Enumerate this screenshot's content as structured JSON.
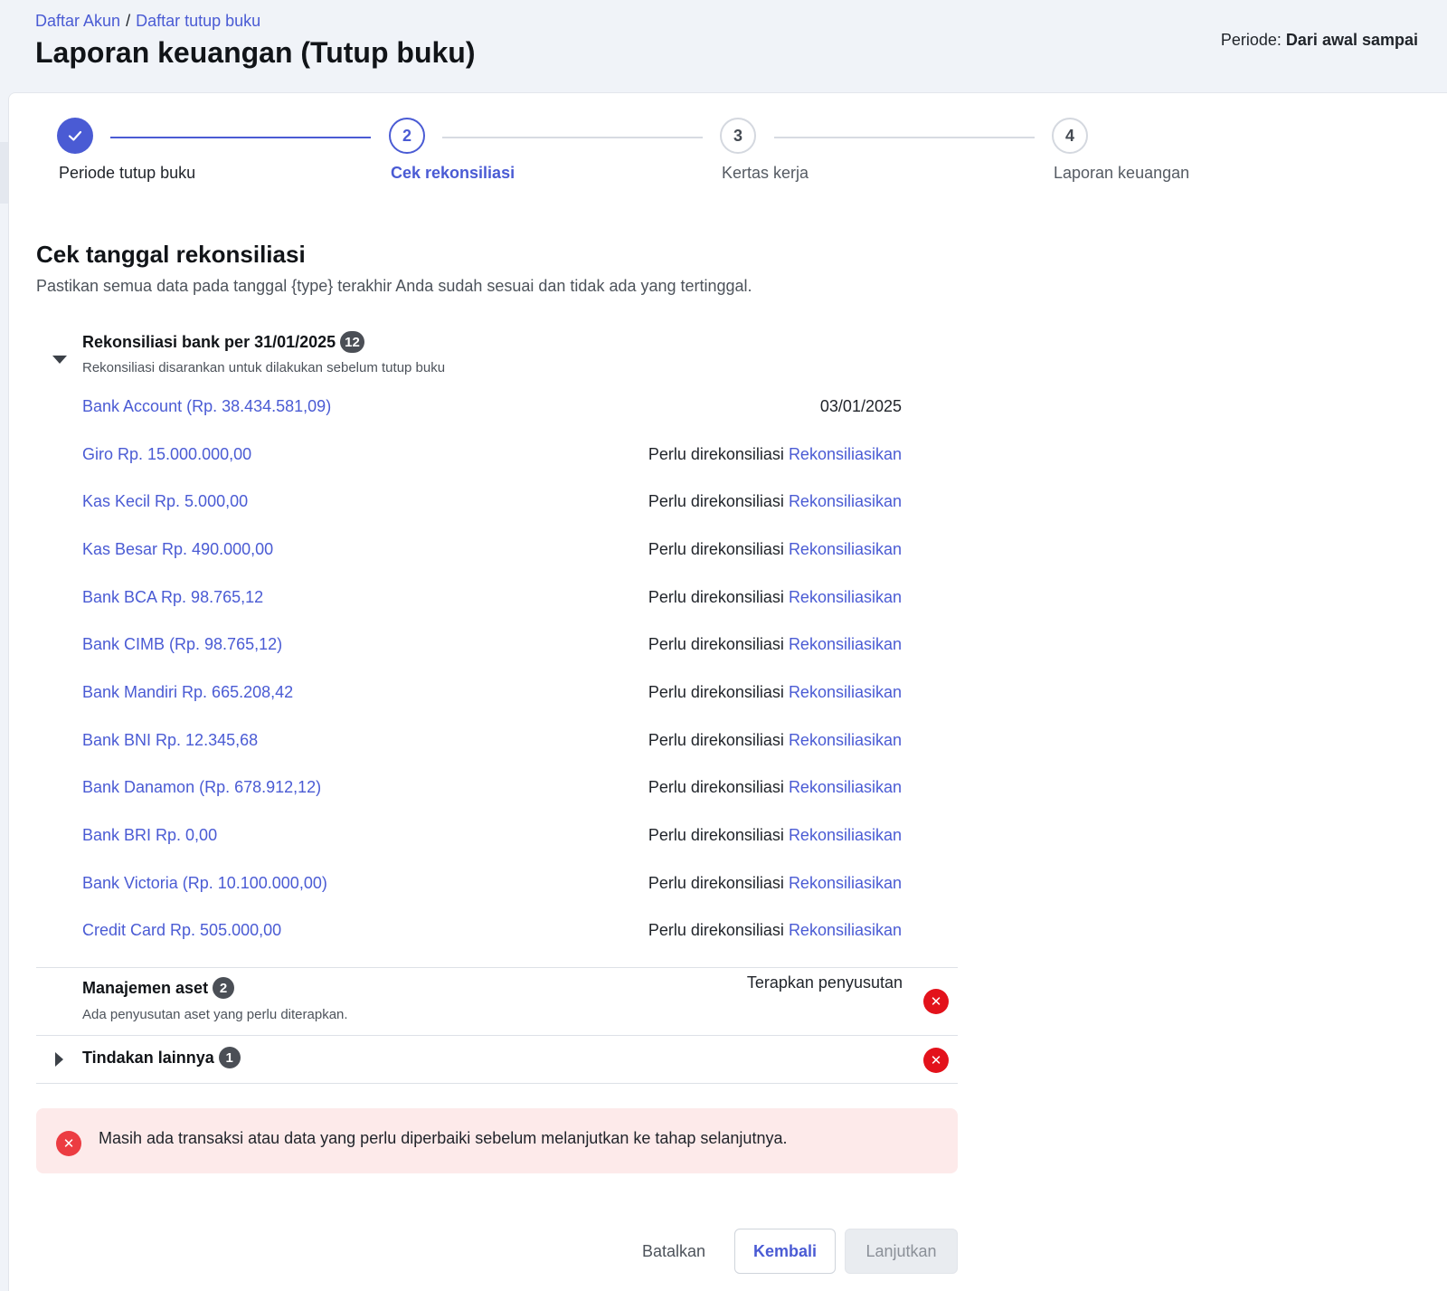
{
  "breadcrumb": {
    "item1": "Daftar Akun",
    "separator": "/",
    "item2": "Daftar tutup buku"
  },
  "page_title": "Laporan keuangan (Tutup buku)",
  "period": {
    "label": "Periode:",
    "value": "Dari awal sampai"
  },
  "stepper": {
    "steps": [
      {
        "number": "✓",
        "label": "Periode tutup buku",
        "state": "done"
      },
      {
        "number": "2",
        "label": "Cek rekonsiliasi",
        "state": "active"
      },
      {
        "number": "3",
        "label": "Kertas kerja",
        "state": "todo"
      },
      {
        "number": "4",
        "label": "Laporan keuangan",
        "state": "todo"
      }
    ]
  },
  "section": {
    "title": "Cek tanggal rekonsiliasi",
    "description": "Pastikan semua data pada tanggal {type} terakhir Anda sudah sesuai dan tidak ada yang tertinggal."
  },
  "bank_group": {
    "title": "Rekonsiliasi bank per 31/01/2025",
    "count": "12",
    "subtitle": "Rekonsiliasi disarankan untuk dilakukan sebelum tutup buku",
    "expanded": true,
    "accounts": [
      {
        "name": "Bank Account (Rp. 38.434.581,09)",
        "status": "03/01/2025",
        "action": ""
      },
      {
        "name": "Giro Rp. 15.000.000,00",
        "status": "Perlu direkonsiliasi",
        "action": "Rekonsiliasikan"
      },
      {
        "name": "Kas Kecil Rp. 5.000,00",
        "status": "Perlu direkonsiliasi",
        "action": "Rekonsiliasikan"
      },
      {
        "name": "Kas Besar Rp. 490.000,00",
        "status": "Perlu direkonsiliasi",
        "action": "Rekonsiliasikan"
      },
      {
        "name": "Bank BCA Rp. 98.765,12",
        "status": "Perlu direkonsiliasi",
        "action": "Rekonsiliasikan"
      },
      {
        "name": "Bank CIMB (Rp. 98.765,12)",
        "status": "Perlu direkonsiliasi",
        "action": "Rekonsiliasikan"
      },
      {
        "name": "Bank Mandiri Rp. 665.208,42",
        "status": "Perlu direkonsiliasi",
        "action": "Rekonsiliasikan"
      },
      {
        "name": "Bank BNI Rp. 12.345,68",
        "status": "Perlu direkonsiliasi",
        "action": "Rekonsiliasikan"
      },
      {
        "name": "Bank Danamon (Rp. 678.912,12)",
        "status": "Perlu direkonsiliasi",
        "action": "Rekonsiliasikan"
      },
      {
        "name": "Bank BRI Rp. 0,00",
        "status": "Perlu direkonsiliasi",
        "action": "Rekonsiliasikan"
      },
      {
        "name": "Bank Victoria (Rp. 10.100.000,00)",
        "status": "Perlu direkonsiliasi",
        "action": "Rekonsiliasikan"
      },
      {
        "name": "Credit Card Rp. 505.000,00",
        "status": "Perlu direkonsiliasi",
        "action": "Rekonsiliasikan"
      }
    ]
  },
  "asset_group": {
    "title": "Manajemen aset",
    "count": "2",
    "subtitle": "Ada penyusutan aset yang perlu diterapkan.",
    "action": "Terapkan penyusutan",
    "icon": "error-icon"
  },
  "other_group": {
    "title": "Tindakan lainnya",
    "count": "1",
    "expanded": false,
    "icon": "error-icon"
  },
  "alert": {
    "message": "Masih ada transaksi atau data yang perlu diperbaiki sebelum melanjutkan ke tahap selanjutnya."
  },
  "footer": {
    "cancel": "Batalkan",
    "back": "Kembali",
    "next": "Lanjutkan"
  },
  "colors": {
    "primary": "#4a5bd4",
    "error": "#e3121b",
    "alert_bg": "#fdeaea"
  }
}
